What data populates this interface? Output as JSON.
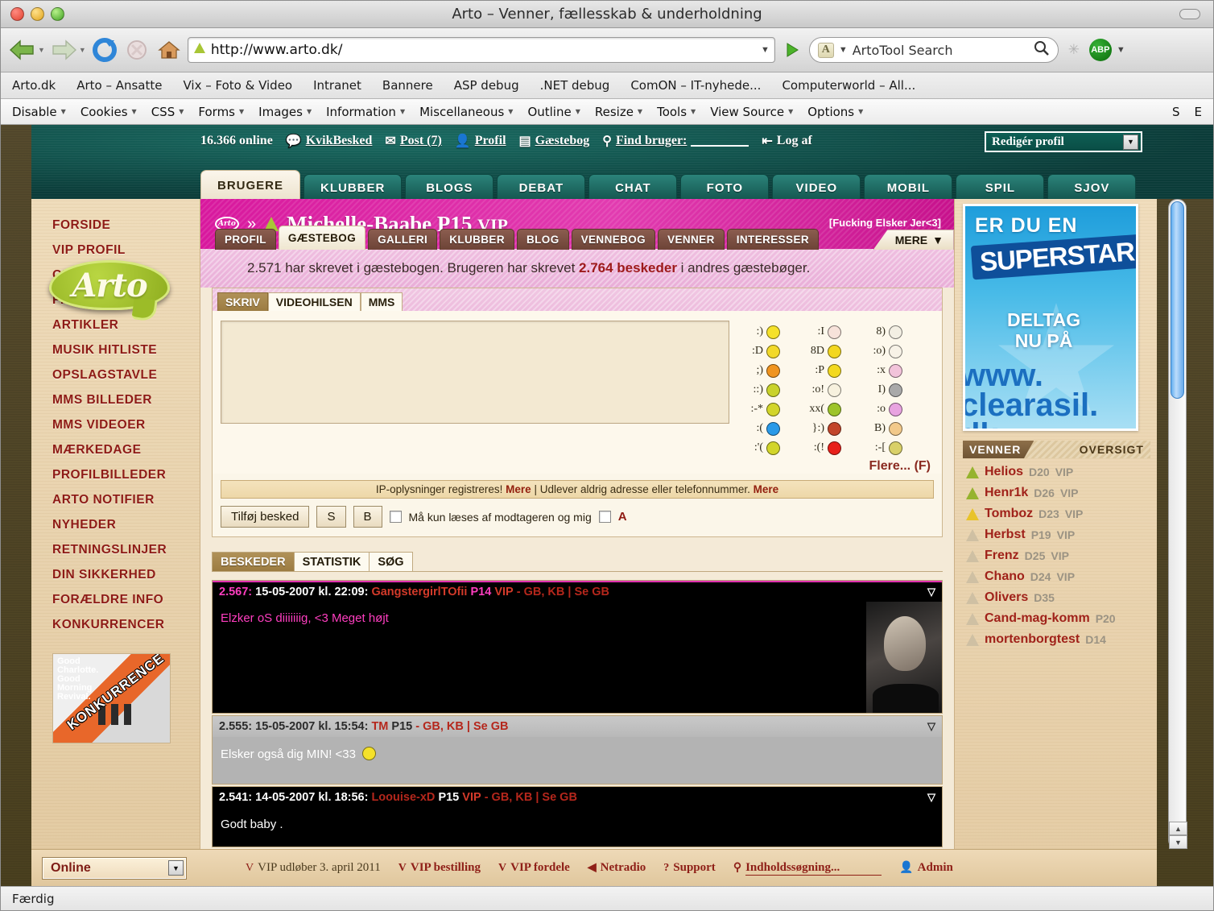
{
  "window": {
    "title": "Arto – Venner, fællesskab & underholdning"
  },
  "browser": {
    "url": "http://www.arto.dk/",
    "search_placeholder": "ArtoTool Search",
    "search_badge": "A",
    "adblock_label": "ABP",
    "status": "Færdig",
    "bookmarks": [
      "Arto.dk",
      "Arto – Ansatte",
      "Vix – Foto & Video",
      "Intranet",
      "Bannere",
      "ASP debug",
      ".NET debug",
      "ComON – IT-nyhede...",
      "Computerworld – All..."
    ],
    "devtoolbar": [
      "Disable",
      "Cookies",
      "CSS",
      "Forms",
      "Images",
      "Information",
      "Miscellaneous",
      "Outline",
      "Resize",
      "Tools",
      "View Source",
      "Options"
    ],
    "devtoolbar_right": [
      "S",
      "E"
    ]
  },
  "site": {
    "logo_text": "Arto",
    "online_count": "16.366 online",
    "topnav": [
      {
        "icon": "speech-bubble-icon",
        "label": "KvikBesked"
      },
      {
        "icon": "envelope-icon",
        "label": "Post (7)"
      },
      {
        "icon": "person-icon",
        "label": "Profil"
      },
      {
        "icon": "book-icon",
        "label": "Gæstebog"
      },
      {
        "icon": "key-icon",
        "label": "Find bruger:"
      },
      {
        "icon": "logout-icon",
        "label": "Log af"
      }
    ],
    "edit_profile": "Redigér profil",
    "main_tabs": [
      {
        "label": "BRUGERE",
        "active": true
      },
      {
        "label": "KLUBBER",
        "active": false
      },
      {
        "label": "BLOGS",
        "active": false
      },
      {
        "label": "DEBAT",
        "active": false
      },
      {
        "label": "CHAT",
        "active": false
      },
      {
        "label": "FOTO",
        "active": false
      },
      {
        "label": "VIDEO",
        "active": false
      },
      {
        "label": "MOBIL",
        "active": false
      },
      {
        "label": "SPIL",
        "active": false
      },
      {
        "label": "SJOV",
        "active": false
      }
    ]
  },
  "sidebar": {
    "items": [
      "FORSIDE",
      "VIP PROFIL",
      "OPRET BRUGER",
      "FIND BRUGER",
      "ARTIKLER",
      "MUSIK HITLISTE",
      "OPSLAGSTAVLE",
      "MMS BILLEDER",
      "MMS VIDEOER",
      "MÆRKEDAGE",
      "PROFILBILLEDER",
      "ARTO NOTIFIER",
      "NYHEDER",
      "RETNINGSLINJER",
      "DIN SIKKERHED",
      "FORÆLDRE INFO",
      "KONKURRENCER"
    ],
    "ad": {
      "title_lines": [
        "Good",
        "Charlotte.",
        "Good",
        "Morning",
        "Revival."
      ],
      "ribbon": "KONKURRENCE"
    }
  },
  "profile": {
    "name": "Michelle-Baabe",
    "age": "P15",
    "vip": "VIP",
    "mood": "[Fucking Elsker Jer<3]",
    "tabs": [
      {
        "label": "PROFIL",
        "active": false
      },
      {
        "label": "GÆSTEBOG",
        "active": true
      },
      {
        "label": "GALLERI",
        "active": false
      },
      {
        "label": "KLUBBER",
        "active": false
      },
      {
        "label": "BLOG",
        "active": false
      },
      {
        "label": "VENNEBOG",
        "active": false
      },
      {
        "label": "VENNER",
        "active": false
      },
      {
        "label": "INTERESSER",
        "active": false
      }
    ],
    "more_label": "MERE"
  },
  "guestbook": {
    "count_prefix": "2.571 har skrevet i gæstebogen. Brugeren har skrevet ",
    "count_bold": "2.764 beskeder",
    "count_suffix": " i andres gæstebøger.",
    "write_tabs": [
      {
        "label": "SKRIV",
        "active": true
      },
      {
        "label": "VIDEOHILSEN",
        "active": false
      },
      {
        "label": "MMS",
        "active": false
      }
    ],
    "textarea_value": "",
    "ip_notice_1": "IP-oplysninger registreres!",
    "ip_more_1": "Mere",
    "ip_sep": "|",
    "ip_notice_2": "Udlever aldrig adresse eller telefonnummer.",
    "ip_more_2": "Mere",
    "submit_label": "Tilføj besked",
    "btn_s": "S",
    "btn_b": "B",
    "private_label": "Må kun læses af modtageren og mig",
    "anon_label": "A",
    "smiley_more": "Flere...",
    "smiley_more_code": "(F)",
    "smileys": [
      [
        {
          "code": ":)",
          "color": "#f5e12a"
        },
        {
          "code": ":I",
          "color": "#f7e2da"
        },
        {
          "code": "8)",
          "color": "#f3efe3"
        }
      ],
      [
        {
          "code": ":D",
          "color": "#f2d92a"
        },
        {
          "code": "8D",
          "color": "#f3d71f"
        },
        {
          "code": ":o)",
          "color": "#f7f2e7"
        }
      ],
      [
        {
          "code": ";)",
          "color": "#f0941f"
        },
        {
          "code": ":P",
          "color": "#f3d91f"
        },
        {
          "code": ":x",
          "color": "#f2c3da"
        }
      ],
      [
        {
          "code": "::)",
          "color": "#c9d22a"
        },
        {
          "code": ":o!",
          "color": "#f7f1de"
        },
        {
          "code": "I)",
          "color": "#a9a9a9"
        }
      ],
      [
        {
          "code": ":-*",
          "color": "#d2d52a"
        },
        {
          "code": "xx(",
          "color": "#9dc42a"
        },
        {
          "code": ":o",
          "color": "#e8a3e0"
        }
      ],
      [
        {
          "code": ":(",
          "color": "#2a9ae8"
        },
        {
          "code": "}:)",
          "color": "#c2452a"
        },
        {
          "code": "B)",
          "color": "#f2c98a"
        }
      ],
      [
        {
          "code": ":'(",
          "color": "#d2d52a"
        },
        {
          "code": ":(!",
          "color": "#e8201a"
        },
        {
          "code": ":-[",
          "color": "#d9d068"
        }
      ]
    ],
    "message_tabs": [
      {
        "label": "BESKEDER",
        "active": true
      },
      {
        "label": "STATISTIK",
        "active": false
      },
      {
        "label": "SØG",
        "active": false
      }
    ],
    "messages": [
      {
        "style": "dark",
        "num": "2.567:",
        "date": "15-05-2007 kl. 22:09:",
        "author": "GangstergirlTOfii",
        "age": "P14",
        "vip": "VIP",
        "links": "- GB, KB | Se GB",
        "body": "Elzker oS diiiiiiig, <3 Meget højt",
        "has_photo": true
      },
      {
        "style": "gray",
        "num": "2.555:",
        "date": "15-05-2007 kl. 15:54:",
        "author": "TM",
        "age": "P15",
        "vip": "",
        "links": "- GB, KB | Se GB",
        "body": "Elsker også dig MIN! <33",
        "has_photo": false
      },
      {
        "style": "dark2",
        "num": "2.541:",
        "date": "14-05-2007 kl. 18:56:",
        "author": "Loouise-xD",
        "age": "P15",
        "vip": "VIP",
        "links": "- GB, KB | Se GB",
        "body": "Godt baby .",
        "has_photo": false
      }
    ]
  },
  "rightcol": {
    "ad": {
      "line1": "ER DU EN",
      "line2": "SUPERSTAR",
      "line3": "DELTAG\nNU PÅ",
      "line4": "www.\nclearasil.\ndk"
    },
    "friends_header_left": "VENNER",
    "friends_header_right": "OVERSIGT",
    "friends": [
      {
        "name": "Helios",
        "age": "D20",
        "vip": "VIP",
        "flag": "on"
      },
      {
        "name": "Henr1k",
        "age": "D26",
        "vip": "VIP",
        "flag": "on"
      },
      {
        "name": "Tomboz",
        "age": "D23",
        "vip": "VIP",
        "flag": "ylw"
      },
      {
        "name": "Herbst",
        "age": "P19",
        "vip": "VIP",
        "flag": "off"
      },
      {
        "name": "Frenz",
        "age": "D25",
        "vip": "VIP",
        "flag": "off"
      },
      {
        "name": "Chano",
        "age": "D24",
        "vip": "VIP",
        "flag": "off"
      },
      {
        "name": "Olivers",
        "age": "D35",
        "vip": "",
        "flag": "off"
      },
      {
        "name": "Cand-mag-komm",
        "age": "P20",
        "vip": "",
        "flag": "off"
      },
      {
        "name": "mortenborgtest",
        "age": "D14",
        "vip": "",
        "flag": "off"
      }
    ]
  },
  "footer": {
    "online_status": "Online",
    "links": [
      {
        "icon": "vip-icon",
        "label": "VIP udløber 3. april 2011",
        "plain": true
      },
      {
        "icon": "vip-icon",
        "label": "VIP bestilling",
        "plain": false
      },
      {
        "icon": "vip-icon",
        "label": "VIP fordele",
        "plain": false
      },
      {
        "icon": "radio-icon",
        "label": "Netradio",
        "plain": false
      },
      {
        "icon": "question-icon",
        "label": "Support",
        "plain": false
      },
      {
        "icon": "key-icon",
        "label": "Indholdssøgning...",
        "plain": false
      },
      {
        "icon": "person-icon",
        "label": "Admin",
        "plain": false
      }
    ]
  }
}
